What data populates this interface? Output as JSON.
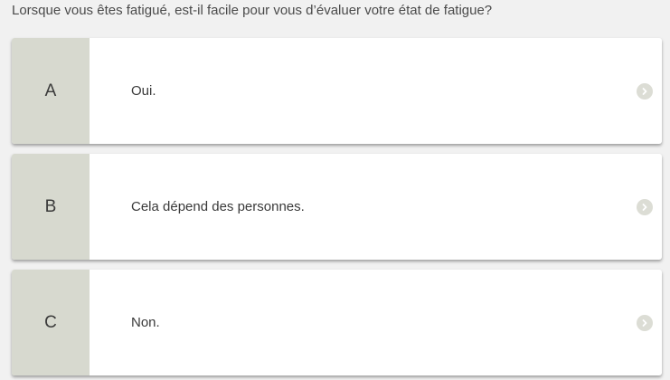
{
  "question": "Lorsque vous êtes fatigué, est-il facile pour vous d’évaluer votre état de fatigue?",
  "options": [
    {
      "letter": "A",
      "text": "Oui."
    },
    {
      "letter": "B",
      "text": "Cela dépend des personnes."
    },
    {
      "letter": "C",
      "text": "Non."
    }
  ],
  "icons": {
    "arrow": "chevron-right-circle-icon"
  },
  "colors": {
    "letter_bg": "#d7d9cf",
    "card_bg": "#ffffff",
    "page_bg": "#f1f1f1",
    "arrow_bg": "#dcddd5"
  }
}
